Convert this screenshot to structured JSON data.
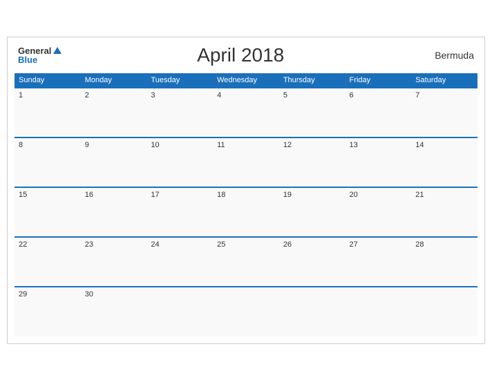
{
  "logo": {
    "general": "General",
    "blue": "Blue",
    "tagline": "GeneralBlue"
  },
  "title": "April 2018",
  "region": "Bermuda",
  "weekdays": [
    "Sunday",
    "Monday",
    "Tuesday",
    "Wednesday",
    "Thursday",
    "Friday",
    "Saturday"
  ],
  "weeks": [
    [
      1,
      2,
      3,
      4,
      5,
      6,
      7
    ],
    [
      8,
      9,
      10,
      11,
      12,
      13,
      14
    ],
    [
      15,
      16,
      17,
      18,
      19,
      20,
      21
    ],
    [
      22,
      23,
      24,
      25,
      26,
      27,
      28
    ],
    [
      29,
      30,
      null,
      null,
      null,
      null,
      null
    ]
  ]
}
